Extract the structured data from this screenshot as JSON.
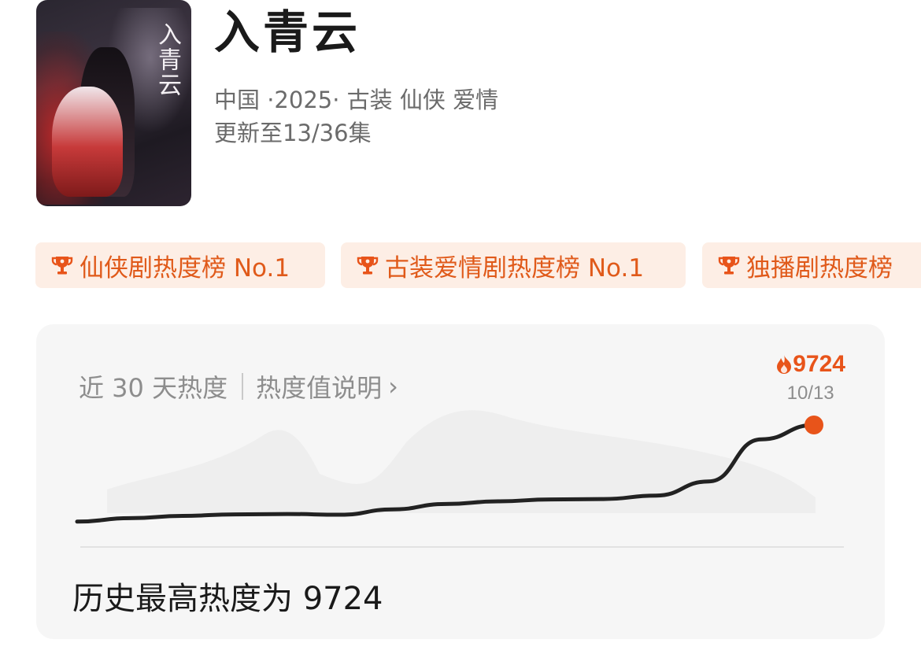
{
  "show": {
    "poster_title": "入青云",
    "title": "入青云",
    "meta": "中国 ·2025· 古装 仙侠 爱情",
    "update": "更新至13/36集"
  },
  "tags": [
    {
      "label": "仙侠剧热度榜 No.1",
      "icon": "trophy-icon"
    },
    {
      "label": "古装爱情剧热度榜 No.1",
      "icon": "trophy-icon"
    },
    {
      "label": "独播剧热度榜",
      "icon": "trophy-icon"
    }
  ],
  "heat_card": {
    "label": "近 30 天热度",
    "explain_link": "热度值说明",
    "chevron": "›",
    "peak_value": "9724",
    "peak_date": "10/13",
    "summary": "历史最高热度为 9724"
  },
  "colors": {
    "accent": "#e8541a",
    "tag_bg": "#fdeee5",
    "line": "#222222",
    "card_bg": "#f6f6f6"
  },
  "chart_data": {
    "type": "line",
    "title": "",
    "xlabel": "",
    "ylabel": "",
    "series": [
      {
        "values": [
          7200,
          7290,
          7350,
          7390,
          7400,
          7380,
          7520,
          7660,
          7730,
          7780,
          7790,
          7880,
          8250,
          9350,
          9724
        ]
      }
    ],
    "ylim": [
      6600,
      10300
    ],
    "grid": false,
    "highlight": {
      "label": "10/13",
      "value": 9724
    }
  }
}
